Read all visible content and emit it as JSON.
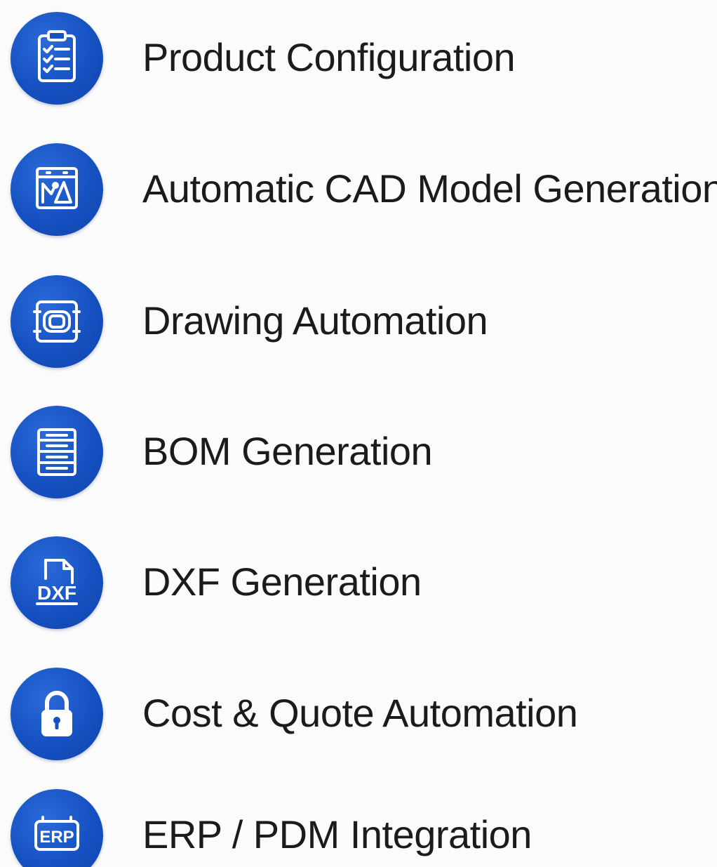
{
  "features": [
    {
      "label": "Product Configuration",
      "icon": "clipboard-checklist-icon"
    },
    {
      "label": "Automatic CAD Model Generation",
      "icon": "cad-model-icon"
    },
    {
      "label": "Drawing Automation",
      "icon": "drawing-frame-icon"
    },
    {
      "label": "BOM Generation",
      "icon": "bom-list-icon"
    },
    {
      "label": "DXF Generation",
      "icon": "dxf-file-icon"
    },
    {
      "label": "Cost & Quote Automation",
      "icon": "padlock-icon"
    },
    {
      "label": "ERP / PDM Integration",
      "icon": "erp-icon"
    }
  ],
  "icon_text": {
    "dxf": "DXF",
    "erp": "ERP"
  },
  "colors": {
    "icon_background": "#1651c1",
    "icon_foreground": "#ffffff",
    "label_text": "#1b1b1b",
    "page_background": "#fbfbfb"
  }
}
